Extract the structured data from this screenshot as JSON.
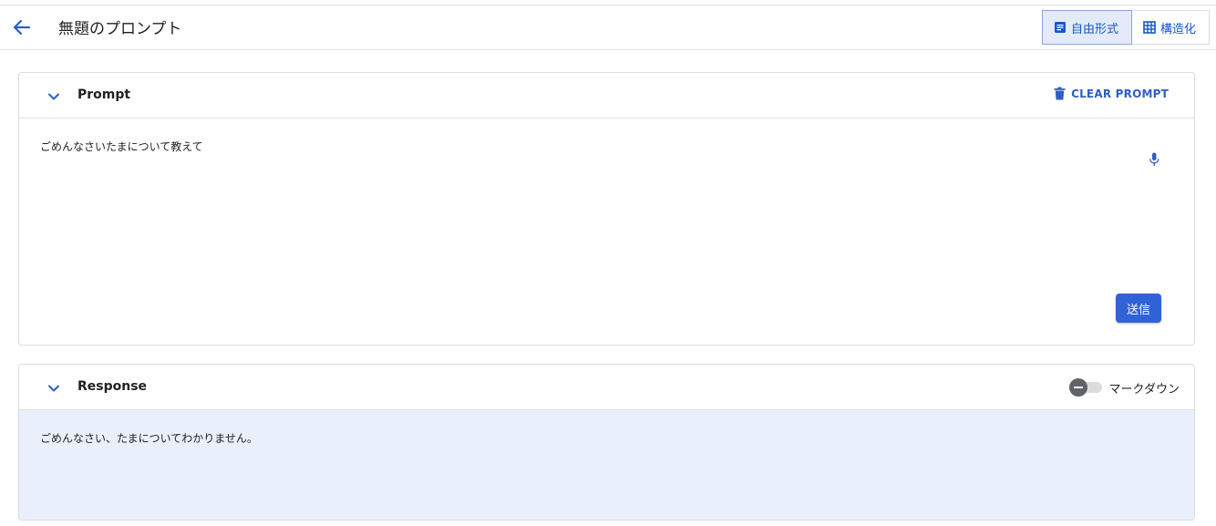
{
  "header": {
    "title": "無題のプロンプト",
    "back_icon": "arrow-back-icon",
    "modes": [
      {
        "label": "自由形式",
        "icon": "document-icon",
        "active": true
      },
      {
        "label": "構造化",
        "icon": "table-icon",
        "active": false
      }
    ]
  },
  "prompt": {
    "title": "Prompt",
    "clear_label": "CLEAR PROMPT",
    "text": "ごめんなさいたまについて教えて",
    "send_label": "送信"
  },
  "response": {
    "title": "Response",
    "markdown_label": "マークダウン",
    "markdown_enabled": false,
    "text": "ごめんなさい、たまについてわかりません。"
  },
  "colors": {
    "accent": "#2f63d6",
    "response_bg": "#e9f0fb"
  }
}
